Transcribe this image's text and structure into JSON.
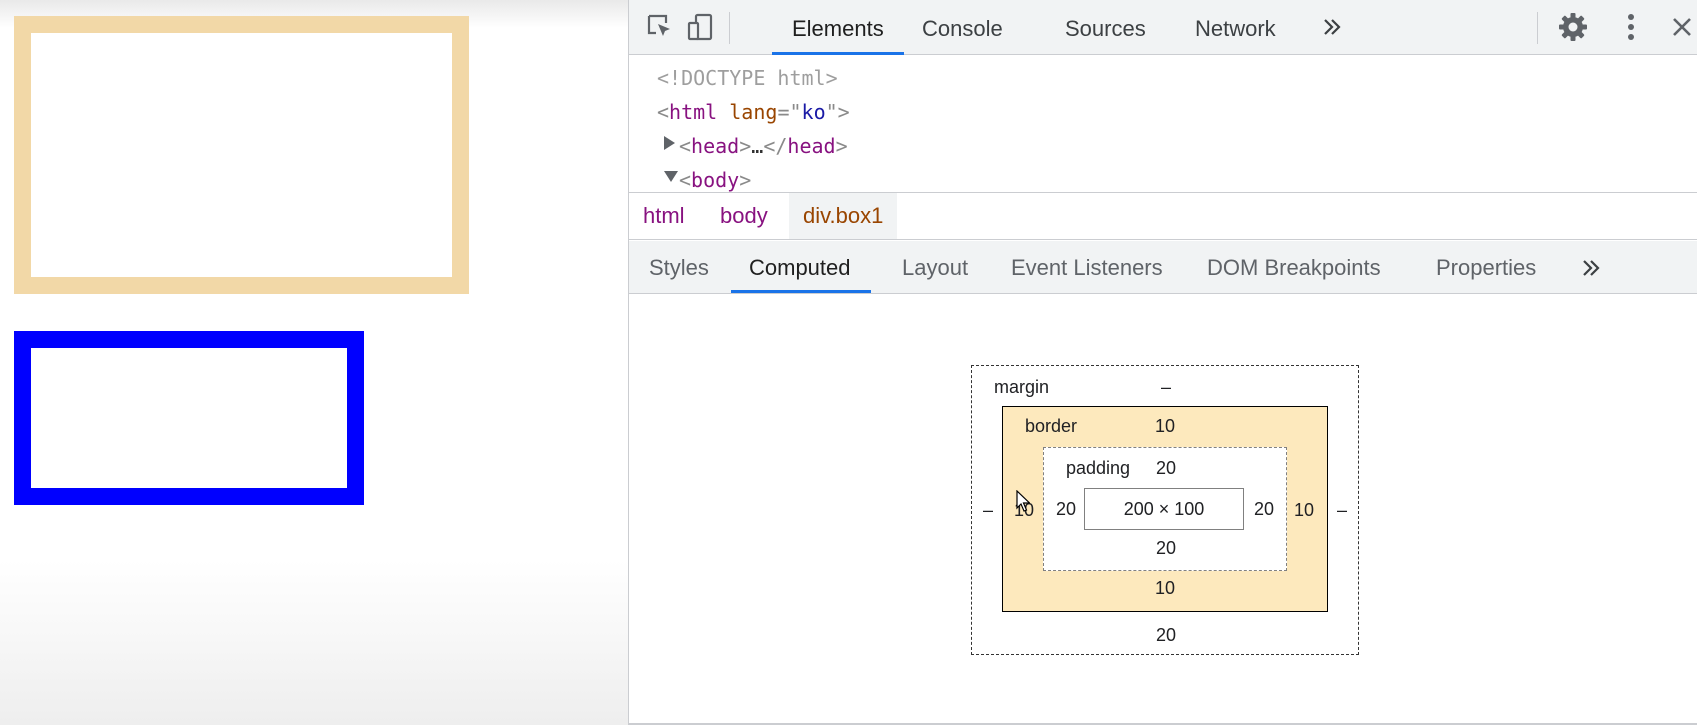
{
  "page": {
    "boxes": [
      {
        "name": "box1",
        "border_color": "#f2d8a7"
      },
      {
        "name": "box2",
        "border_color": "#0000ff"
      }
    ]
  },
  "devtools": {
    "toolbar": {
      "inspect_icon": "inspect-element-icon",
      "device_icon": "device-toolbar-icon",
      "tabs": [
        "Elements",
        "Console",
        "Sources",
        "Network"
      ],
      "active_tab": "Elements",
      "more_tabs_icon": "double-chevron-icon",
      "settings_icon": "gear-icon",
      "menu_icon": "vertical-dots-icon",
      "close_icon": "close-icon"
    },
    "dom_tree": {
      "doctype": "<!DOCTYPE html>",
      "html_tag": "html",
      "html_attr_name": "lang",
      "html_attr_value": "ko",
      "head_tag": "head",
      "head_ellipsis": "…",
      "body_tag": "body"
    },
    "breadcrumbs": [
      "html",
      "body",
      "div.box1"
    ],
    "sub_tabs": [
      "Styles",
      "Computed",
      "Layout",
      "Event Listeners",
      "DOM Breakpoints",
      "Properties"
    ],
    "active_sub_tab": "Computed",
    "box_model": {
      "margin": {
        "label": "margin",
        "top": "–",
        "right": "–",
        "bottom": "20",
        "left": "–"
      },
      "border": {
        "label": "border",
        "top": "10",
        "right": "10",
        "bottom": "10",
        "left": "10"
      },
      "padding": {
        "label": "padding",
        "top": "20",
        "right": "20",
        "bottom": "20",
        "left": "20"
      },
      "content": "200 × 100"
    },
    "accent_color": "#1a73e8"
  }
}
